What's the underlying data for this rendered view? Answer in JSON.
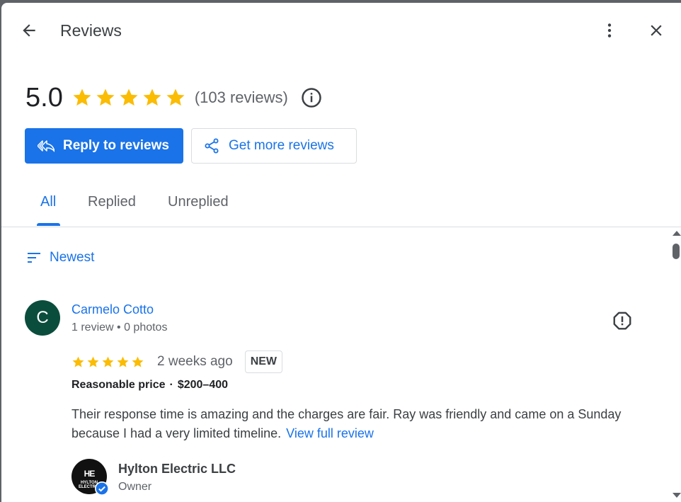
{
  "header": {
    "title": "Reviews"
  },
  "summary": {
    "rating": "5.0",
    "stars": 5,
    "review_count": "(103 reviews)"
  },
  "actions": {
    "reply_label": "Reply to reviews",
    "get_more_label": "Get more reviews"
  },
  "tabs": [
    {
      "label": "All",
      "active": true
    },
    {
      "label": "Replied",
      "active": false
    },
    {
      "label": "Unreplied",
      "active": false
    }
  ],
  "sort": {
    "label": "Newest"
  },
  "review": {
    "avatar_letter": "C",
    "name": "Carmelo Cotto",
    "meta": "1 review • 0 photos",
    "stars": 5,
    "date": "2 weeks ago",
    "badge": "NEW",
    "price_label": "Reasonable price",
    "price_dot": "·",
    "price_value": "$200–400",
    "text": "Their response time is amazing and the charges are fair. Ray was friendly and came on a Sunday because I had a very limited timeline.",
    "view_full": "View full review"
  },
  "owner": {
    "logo_initials": "HE",
    "logo_text": "HYLTON ELECTRIC",
    "name": "Hylton Electric LLC",
    "role": "Owner"
  },
  "colors": {
    "accent": "#1a73e8",
    "star": "#fbbc04",
    "avatar": "#0b4d3c"
  }
}
